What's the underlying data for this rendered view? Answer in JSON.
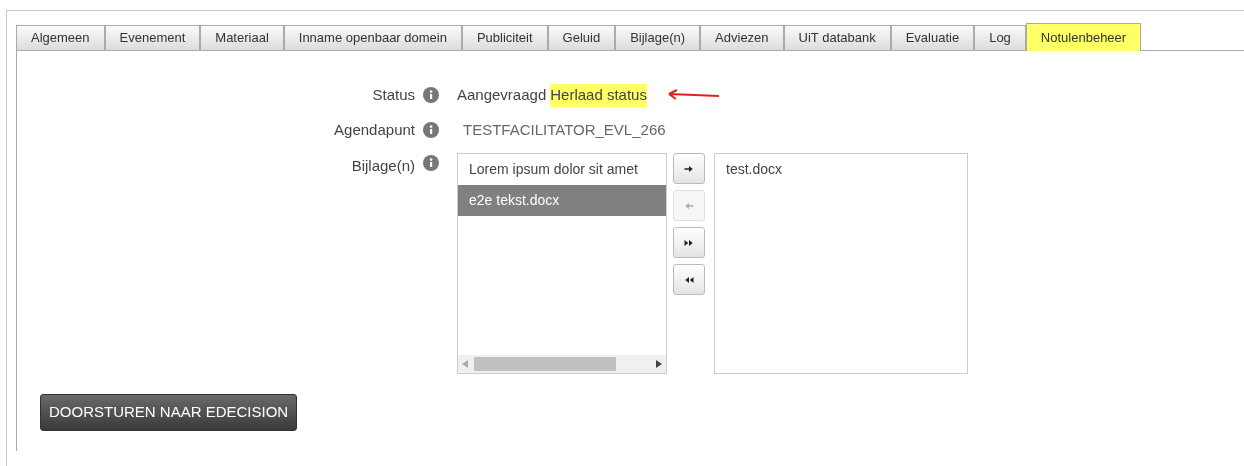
{
  "tabs": [
    {
      "label": "Algemeen",
      "selected": false
    },
    {
      "label": "Evenement",
      "selected": false
    },
    {
      "label": "Materiaal",
      "selected": false
    },
    {
      "label": "Inname openbaar domein",
      "selected": false
    },
    {
      "label": "Publiciteit",
      "selected": false
    },
    {
      "label": "Geluid",
      "selected": false
    },
    {
      "label": "Bijlage(n)",
      "selected": false
    },
    {
      "label": "Adviezen",
      "selected": false
    },
    {
      "label": "UiT databank",
      "selected": false
    },
    {
      "label": "Evaluatie",
      "selected": false
    },
    {
      "label": "Log",
      "selected": false
    },
    {
      "label": "Notulenbeheer",
      "selected": true
    }
  ],
  "status": {
    "label": "Status",
    "value": "Aangevraagd",
    "link": "Herlaad status",
    "link_highlighted": true
  },
  "agendapunt": {
    "label": "Agendapunt",
    "value": "TESTFACILITATOR_EVL_266"
  },
  "bijlagen": {
    "label": "Bijlage(n)",
    "available": [
      {
        "name": "Lorem ipsum dolor sit amet",
        "selected": false
      },
      {
        "name": "e2e tekst.docx",
        "selected": true
      }
    ],
    "move_buttons": [
      {
        "kind": "right",
        "disabled": false
      },
      {
        "kind": "left",
        "disabled": true
      },
      {
        "kind": "all-right",
        "disabled": false
      },
      {
        "kind": "all-left",
        "disabled": false
      }
    ],
    "chosen": [
      {
        "name": "test.docx",
        "selected": false
      }
    ]
  },
  "submit_button": "DOORSTUREN NAAR EDECISION"
}
